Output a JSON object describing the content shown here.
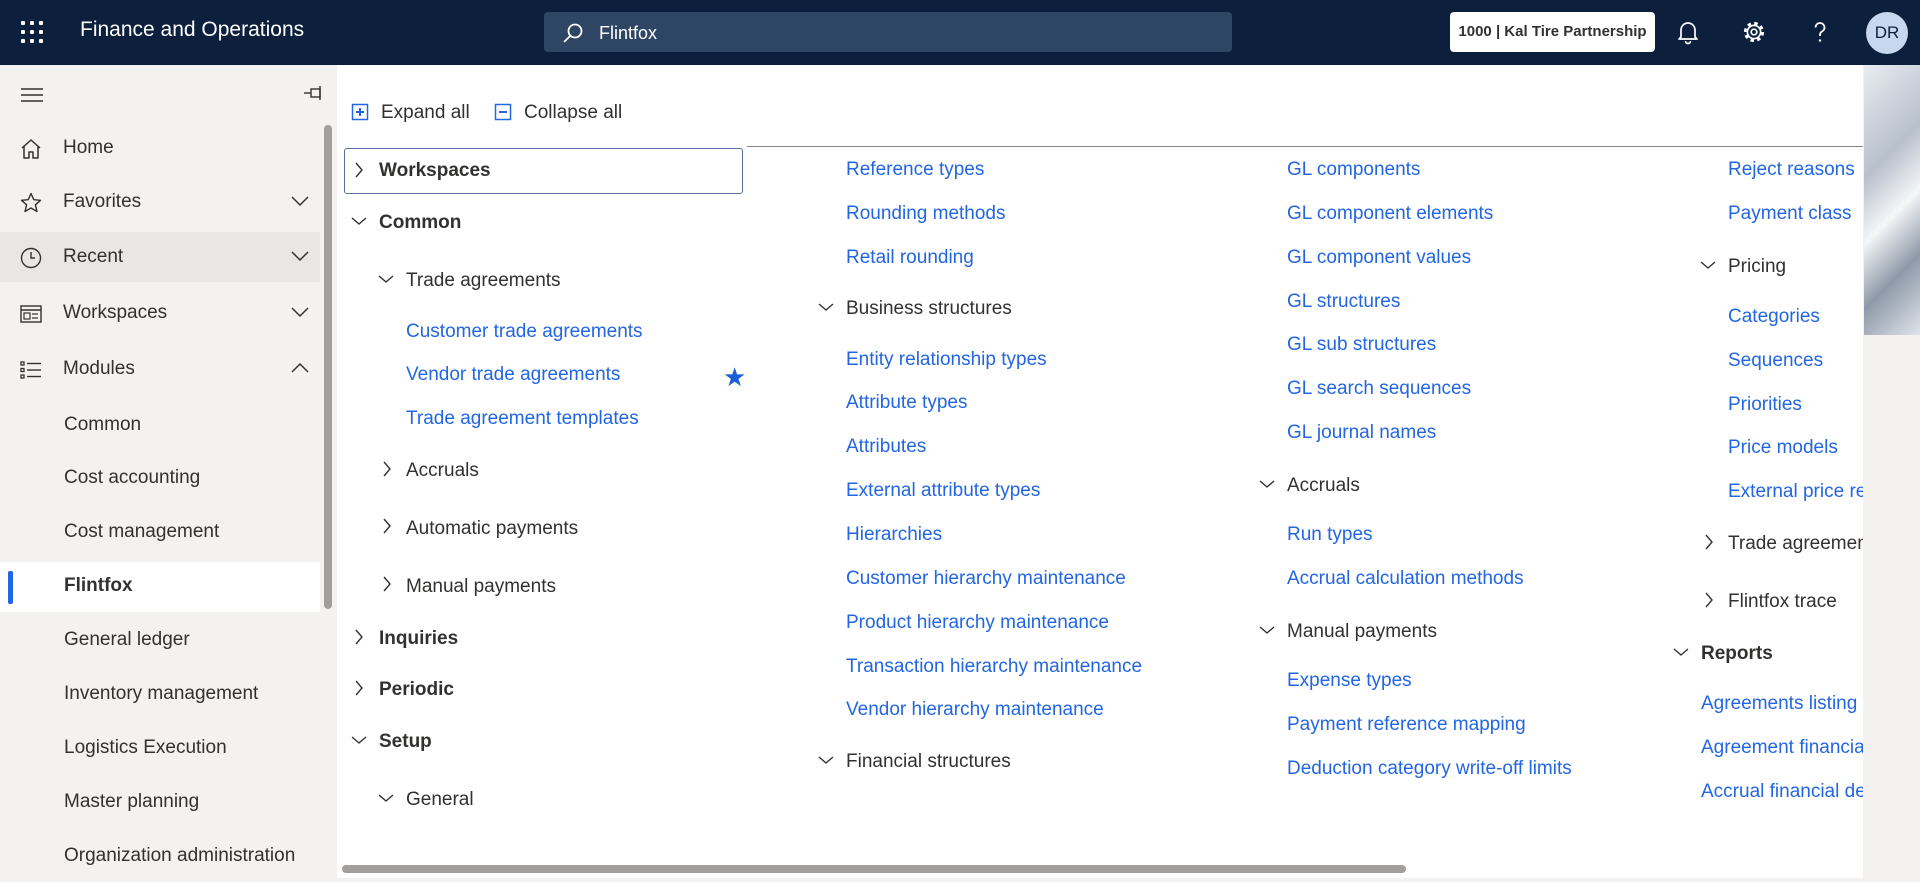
{
  "header": {
    "app_title": "Finance and Operations",
    "search_value": "Flintfox",
    "company": "1000 | Kal Tire Partnership",
    "avatar": "DR"
  },
  "nav": {
    "top": [
      {
        "label": "Home",
        "icon": "home-icon"
      },
      {
        "label": "Favorites",
        "icon": "star-outline-icon"
      },
      {
        "label": "Recent",
        "icon": "clock-icon"
      },
      {
        "label": "Workspaces",
        "icon": "workspace-icon"
      },
      {
        "label": "Modules",
        "icon": "list-icon"
      }
    ],
    "modules": [
      "Common",
      "Cost accounting",
      "Cost management",
      "Flintfox",
      "General ledger",
      "Inventory management",
      "Logistics Execution",
      "Master planning",
      "Organization administration"
    ],
    "active_module": "Flintfox"
  },
  "toolbar": {
    "expand_all": "Expand all",
    "collapse_all": "Collapse all"
  },
  "menu": {
    "col1": {
      "workspaces": "Workspaces",
      "common": "Common",
      "trade_agreements": "Trade agreements",
      "customer_trade_agreements": "Customer trade agreements",
      "vendor_trade_agreements": "Vendor trade agreements",
      "trade_agreement_templates": "Trade agreement templates",
      "accruals": "Accruals",
      "automatic_payments": "Automatic payments",
      "manual_payments": "Manual payments",
      "inquiries": "Inquiries",
      "periodic": "Periodic",
      "setup": "Setup",
      "general": "General"
    },
    "col2": {
      "reference_types": "Reference types",
      "rounding_methods": "Rounding methods",
      "retail_rounding": "Retail rounding",
      "business_structures": "Business structures",
      "entity_relationship_types": "Entity relationship types",
      "attribute_types": "Attribute types",
      "attributes": "Attributes",
      "external_attribute_types": "External attribute types",
      "hierarchies": "Hierarchies",
      "customer_hierarchy_maintenance": "Customer hierarchy maintenance",
      "product_hierarchy_maintenance": "Product hierarchy maintenance",
      "transaction_hierarchy_maintenance": "Transaction hierarchy maintenance",
      "vendor_hierarchy_maintenance": "Vendor hierarchy maintenance",
      "financial_structures": "Financial structures"
    },
    "col3": {
      "gl_components": "GL components",
      "gl_component_elements": "GL component elements",
      "gl_component_values": "GL component values",
      "gl_structures": "GL structures",
      "gl_sub_structures": "GL sub structures",
      "gl_search_sequences": "GL search sequences",
      "gl_journal_names": "GL journal names",
      "accruals": "Accruals",
      "run_types": "Run types",
      "accrual_calculation_methods": "Accrual calculation methods",
      "manual_payments": "Manual payments",
      "expense_types": "Expense types",
      "payment_reference_mapping": "Payment reference mapping",
      "deduction_category_write_off_limits": "Deduction category write-off limits"
    },
    "col4": {
      "reject_reasons": "Reject reasons",
      "payment_class": "Payment class",
      "pricing": "Pricing",
      "categories": "Categories",
      "sequences": "Sequences",
      "priorities": "Priorities",
      "price_models": "Price models",
      "external_price": "External price re",
      "trade_agreements": "Trade agreement",
      "flintfox_trace": "Flintfox trace",
      "reports": "Reports",
      "agreements_listing": "Agreements listing",
      "agreement_financial": "Agreement financia",
      "accrual_financial": "Accrual financial de"
    }
  }
}
